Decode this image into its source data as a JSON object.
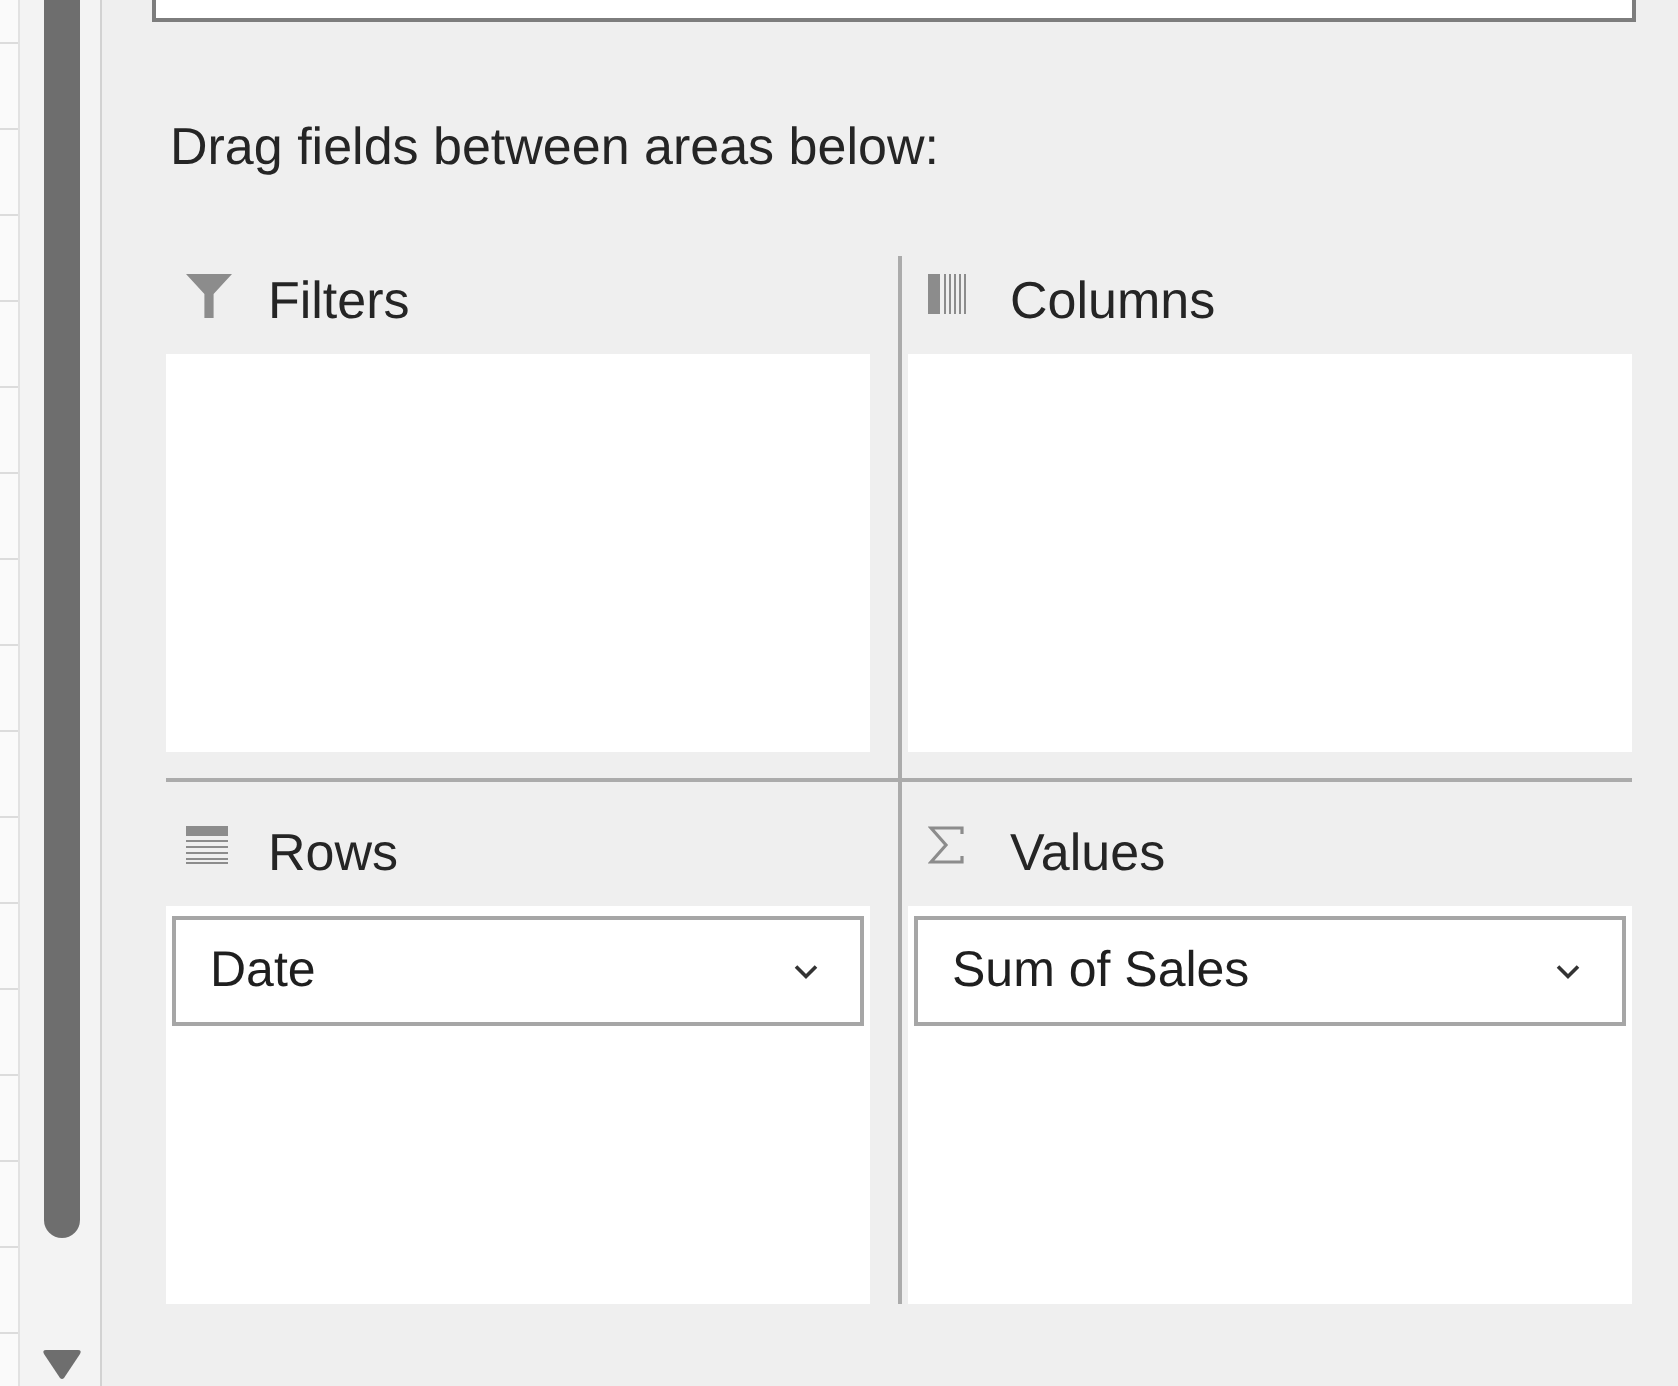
{
  "instruction": "Drag fields between areas below:",
  "areas": [
    {
      "kind": "filters",
      "label": "Filters"
    },
    {
      "kind": "columns",
      "label": "Columns"
    },
    {
      "kind": "rows",
      "label": "Rows",
      "fields": [
        {
          "label": "Date"
        }
      ]
    },
    {
      "kind": "values",
      "label": "Values",
      "fields": [
        {
          "label": "Sum of Sales"
        }
      ]
    }
  ]
}
